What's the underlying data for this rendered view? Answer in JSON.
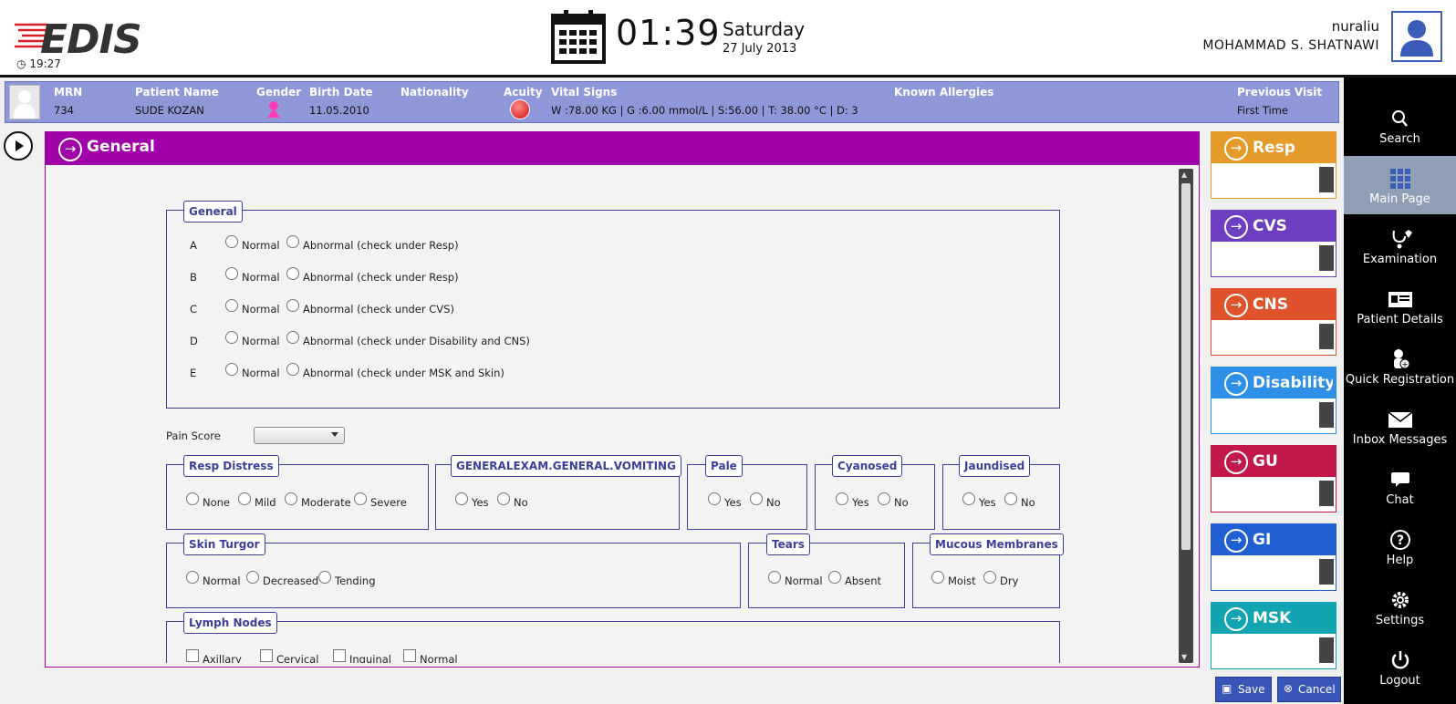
{
  "header": {
    "logo": "EDIS",
    "timer": "19:27",
    "time": "01:39",
    "day": "Saturday",
    "date": "27 July 2013",
    "username": "nuraliu",
    "fullname": "MOHAMMAD S.  SHATNAWI"
  },
  "patient": {
    "mrn_label": "MRN",
    "mrn": "734",
    "name_label": "Patient Name",
    "name": "SUDE KOZAN",
    "gender_label": "Gender",
    "birth_label": "Birth Date",
    "birth": "11.05.2010",
    "nationality_label": "Nationality",
    "nationality": "",
    "acuity_label": "Acuity",
    "vitals_label": "Vital Signs",
    "vitals": "W :78.00 KG | G :6.00 mmol/L  |  S:56.00  |  T: 38.00 °C  |  D: 3",
    "allergies_label": "Known Allergies",
    "allergies": "",
    "prev_label": "Previous Visit",
    "prev": "First Time"
  },
  "panel": {
    "title": "General",
    "general": {
      "legend": "General",
      "rows": [
        {
          "letter": "A",
          "normal": "Normal",
          "abnormal": "Abnormal (check under Resp)"
        },
        {
          "letter": "B",
          "normal": "Normal",
          "abnormal": "Abnormal (check under Resp)"
        },
        {
          "letter": "C",
          "normal": "Normal",
          "abnormal": "Abnormal (check under CVS)"
        },
        {
          "letter": "D",
          "normal": "Normal",
          "abnormal": "Abnormal (check under Disability and CNS)"
        },
        {
          "letter": "E",
          "normal": "Normal",
          "abnormal": "Abnormal (check under MSK and Skin)"
        }
      ]
    },
    "pain_score_label": "Pain Score",
    "pain_score_value": "",
    "resp_distress": {
      "legend": "Resp Distress",
      "options": [
        "None",
        "Mild",
        "Moderate",
        "Severe"
      ]
    },
    "vomiting": {
      "legend": "GENERALEXAM.GENERAL.VOMITING",
      "options": [
        "Yes",
        "No"
      ]
    },
    "pale": {
      "legend": "Pale",
      "options": [
        "Yes",
        "No"
      ]
    },
    "cyanosed": {
      "legend": "Cyanosed",
      "options": [
        "Yes",
        "No"
      ]
    },
    "jaundised": {
      "legend": "Jaundised",
      "options": [
        "Yes",
        "No"
      ]
    },
    "skin_turgor": {
      "legend": "Skin Turgor",
      "options": [
        "Normal",
        "Decreased",
        "Tending"
      ]
    },
    "tears": {
      "legend": "Tears",
      "options": [
        "Normal",
        "Absent"
      ]
    },
    "mucous": {
      "legend": "Mucous Membranes",
      "options": [
        "Moist",
        "Dry"
      ]
    },
    "lymph": {
      "legend": "Lymph Nodes",
      "options": [
        "Axillary",
        "Cervical",
        "Inguinal",
        "Normal"
      ]
    }
  },
  "cards": [
    {
      "title": "Resp",
      "color": "#e49b2a"
    },
    {
      "title": "CVS",
      "color": "#6b3fbf"
    },
    {
      "title": "CNS",
      "color": "#e0522b"
    },
    {
      "title": "Disability",
      "color": "#2e8fe6"
    },
    {
      "title": "GU",
      "color": "#c2184a"
    },
    {
      "title": "GI",
      "color": "#1f5fd1"
    },
    {
      "title": "MSK",
      "color": "#12a4b0"
    }
  ],
  "nav": [
    {
      "label": "Search",
      "icon": "search-icon"
    },
    {
      "label": "Main Page",
      "icon": "grid-icon"
    },
    {
      "label": "Examination",
      "icon": "stethoscope-icon"
    },
    {
      "label": "Patient Details",
      "icon": "id-card-icon"
    },
    {
      "label": "Quick Registration",
      "icon": "add-user-icon"
    },
    {
      "label": "Inbox Messages",
      "icon": "envelope-icon"
    },
    {
      "label": "Chat",
      "icon": "chat-icon"
    },
    {
      "label": "Help",
      "icon": "help-icon"
    },
    {
      "label": "Settings",
      "icon": "gear-icon"
    },
    {
      "label": "Logout",
      "icon": "power-icon"
    }
  ],
  "buttons": {
    "save": "Save",
    "cancel": "Cancel"
  }
}
